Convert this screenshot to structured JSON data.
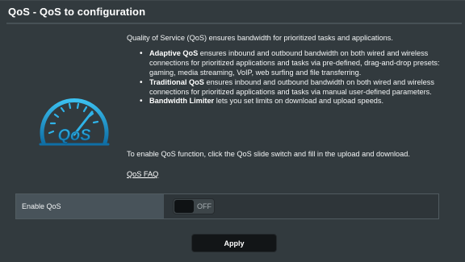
{
  "header": {
    "title": "QoS - QoS to configuration"
  },
  "logo": {
    "icon": "qos-gauge-icon",
    "text": "QoS",
    "color": "#1e9fd8"
  },
  "content": {
    "intro": "Quality of Service (QoS) ensures bandwidth for prioritized tasks and applications.",
    "bullets": [
      {
        "title": "Adaptive QoS",
        "text": " ensures inbound and outbound bandwidth on both wired and wireless connections for prioritized applications and tasks via pre-defined, drag-and-drop presets: gaming, media streaming, VoIP, web surfing and file transferring."
      },
      {
        "title": "Traditional QoS",
        "text": " ensures inbound and outbound bandwidth on both wired and wireless connections for prioritized applications and tasks via manual user-defined parameters."
      },
      {
        "title": "Bandwidth Limiter",
        "text": " lets you set limits on download and upload speeds."
      }
    ],
    "enable_text": "To enable QoS function, click the QoS slide switch and fill in the upload and download.",
    "faq_link": "QoS FAQ"
  },
  "settings": {
    "enable_label": "Enable QoS",
    "toggle_state": "OFF"
  },
  "actions": {
    "apply_label": "Apply"
  },
  "colors": {
    "background": "#323a3e",
    "label_cell": "#48535a",
    "accent": "#1e9fd8",
    "button": "#121517"
  }
}
